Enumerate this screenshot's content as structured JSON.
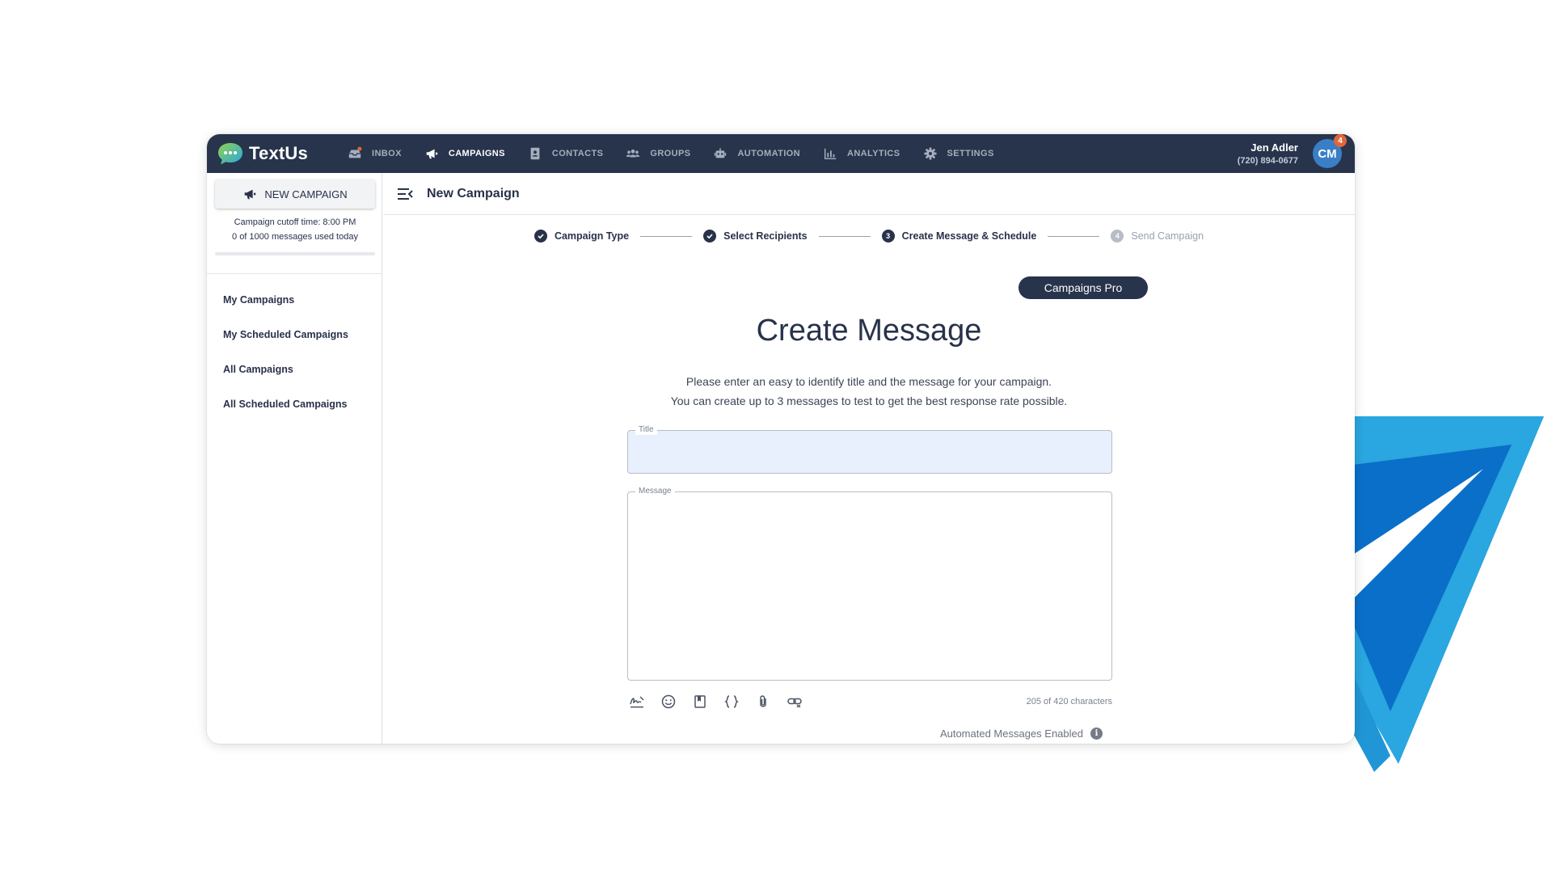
{
  "app": {
    "brand": "TextUs"
  },
  "nav": {
    "items": [
      {
        "label": "INBOX",
        "icon": "inbox-icon"
      },
      {
        "label": "CAMPAIGNS",
        "icon": "megaphone-icon"
      },
      {
        "label": "CONTACTS",
        "icon": "contact-book-icon"
      },
      {
        "label": "GROUPS",
        "icon": "groups-icon"
      },
      {
        "label": "AUTOMATION",
        "icon": "robot-icon"
      },
      {
        "label": "ANALYTICS",
        "icon": "bar-chart-icon"
      },
      {
        "label": "SETTINGS",
        "icon": "gear-icon"
      }
    ],
    "active": "CAMPAIGNS"
  },
  "user": {
    "name": "Jen Adler",
    "phone": "(720) 894-0677",
    "initials": "CM",
    "notifications": "4"
  },
  "sidebar": {
    "new_campaign": "NEW CAMPAIGN",
    "cutoff_line": "Campaign cutoff time: 8:00 PM",
    "usage_line": "0 of 1000 messages used today",
    "usage_fraction": 0,
    "items": [
      "My Campaigns",
      "My Scheduled Campaigns",
      "All Campaigns",
      "All Scheduled Campaigns"
    ]
  },
  "main": {
    "title": "New Campaign",
    "steps": [
      {
        "label": "Campaign Type",
        "state": "complete"
      },
      {
        "label": "Select Recipients",
        "state": "complete"
      },
      {
        "label": "Create Message & Schedule",
        "state": "current",
        "number": "3"
      },
      {
        "label": "Send Campaign",
        "state": "upcoming",
        "number": "4"
      }
    ],
    "pill": "Campaigns Pro",
    "heading": "Create Message",
    "instructions": [
      "Please enter an easy to identify title and the message for your campaign.",
      "You can create up to 3 messages to test to get the best response rate possible."
    ],
    "title_label": "Title",
    "title_value": "",
    "message_label": "Message",
    "message_value": "",
    "char_count": "205 of 420 characters",
    "automated_messages": "Automated Messages Enabled",
    "toolbar": [
      "signature-icon",
      "emoji-icon",
      "template-icon",
      "variables-icon",
      "attachment-icon",
      "link-icon"
    ]
  },
  "colors": {
    "nav_bg": "#27344c",
    "title_field_bg": "#e8f0fe",
    "plane_dark": "#0a6fc9",
    "plane_light": "#2aa6e0"
  }
}
